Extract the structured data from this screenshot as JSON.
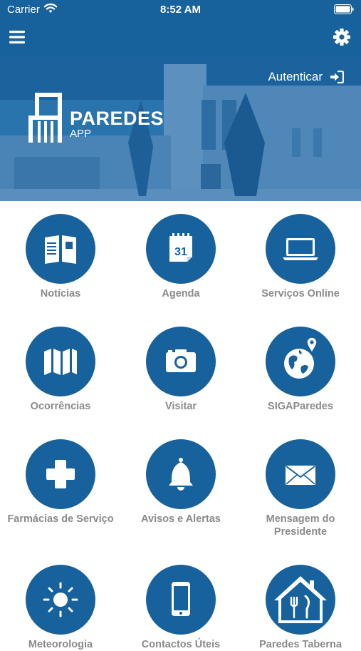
{
  "status": {
    "carrier": "Carrier",
    "time": "8:52 AM"
  },
  "nav": {
    "menu_icon": "hamburger-menu-icon",
    "settings_icon": "gear-icon"
  },
  "hero": {
    "auth_label": "Autenticar",
    "auth_icon": "sign-in-icon",
    "logo_name": "PAREDES",
    "logo_sub": "APP"
  },
  "colors": {
    "brand": "#17619c",
    "label": "#8a8a8a",
    "background": "#ffffff"
  },
  "tiles": [
    {
      "label": "Notícias",
      "icon": "newspaper-icon"
    },
    {
      "label": "Agenda",
      "icon": "calendar-icon"
    },
    {
      "label": "Serviços Online",
      "icon": "laptop-icon"
    },
    {
      "label": "Ocorrências",
      "icon": "map-icon"
    },
    {
      "label": "Visitar",
      "icon": "camera-icon"
    },
    {
      "label": "SIGAParedes",
      "icon": "globe-pin-icon"
    },
    {
      "label": "Farmácias de Serviço",
      "icon": "medical-cross-icon"
    },
    {
      "label": "Avisos e Alertas",
      "icon": "bell-icon"
    },
    {
      "label": "Mensagem do Presidente",
      "icon": "envelope-icon"
    },
    {
      "label": "Meteorologia",
      "icon": "sun-icon"
    },
    {
      "label": "Contactos Úteis",
      "icon": "phone-icon"
    },
    {
      "label": "Paredes Taberna",
      "icon": "house-restaurant-icon"
    }
  ]
}
